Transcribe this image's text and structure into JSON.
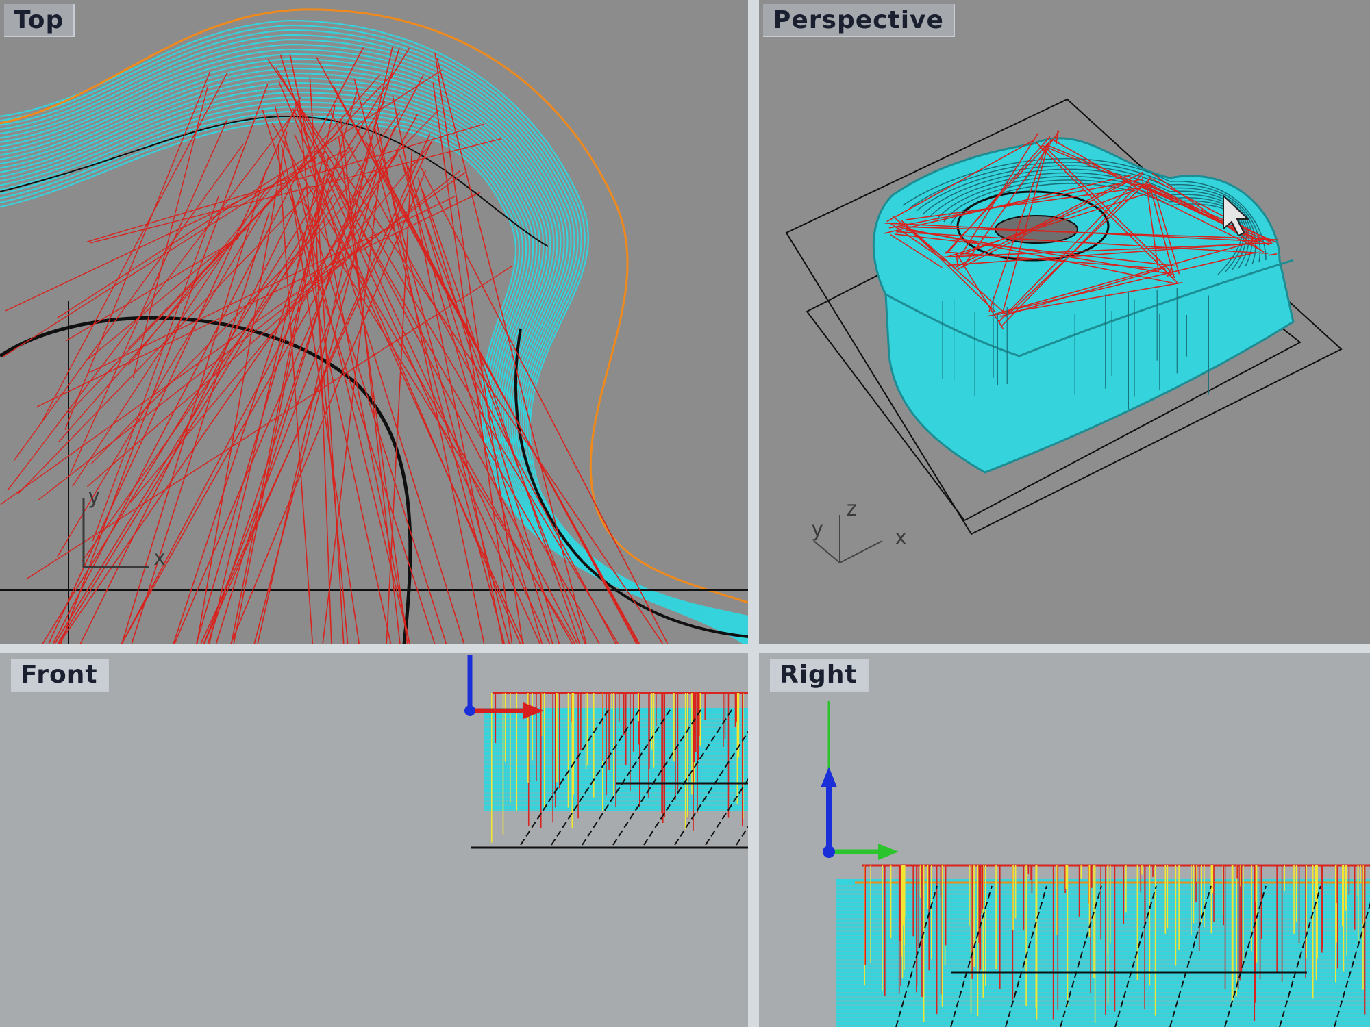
{
  "viewports": {
    "top": {
      "title": "Top",
      "axes": {
        "x": "x",
        "y": "y"
      }
    },
    "perspective": {
      "title": "Perspective",
      "axes": {
        "x": "x",
        "y": "y",
        "z": "z"
      }
    },
    "front": {
      "title": "Front"
    },
    "right": {
      "title": "Right"
    }
  },
  "colors": {
    "toolpath_cyan": "#35d3dc",
    "rapid_red": "#d8231e",
    "boundary_orange": "#f08a1c",
    "plunge_yellow": "#f2e633",
    "geometry_black": "#101010",
    "gumball_x": "#d81f1f",
    "gumball_y": "#2cc42c",
    "gumball_z": "#1b2fd8",
    "viewport_bg": "#8c8c8c"
  },
  "icons": [
    "cursor-arrow-icon",
    "gumball-widget-icon",
    "axis-triad-icon"
  ]
}
